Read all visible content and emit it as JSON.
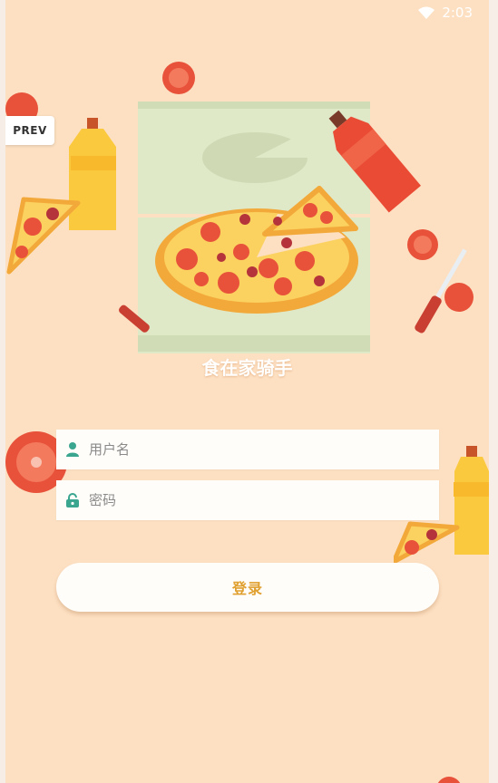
{
  "status_bar": {
    "time": "2:03",
    "wifi_icon": "wifi-icon"
  },
  "nav": {
    "prev_label": "PREV"
  },
  "app": {
    "title": "食在家骑手"
  },
  "form": {
    "username_placeholder": "用户名",
    "username_icon": "user-icon",
    "password_placeholder": "密码",
    "password_icon": "lock-icon",
    "login_label": "登录"
  },
  "colors": {
    "background": "#fde0c2",
    "accent": "#e0a030",
    "icon": "#3aa690"
  }
}
